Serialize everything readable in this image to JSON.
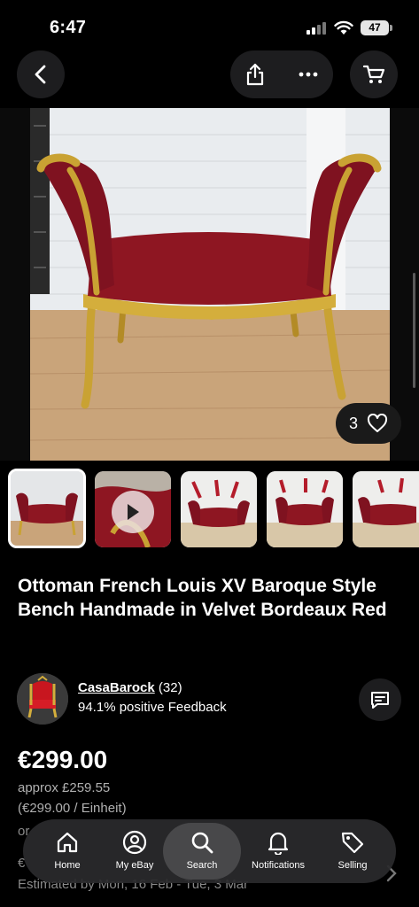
{
  "status_bar": {
    "time": "6:47",
    "battery": "47"
  },
  "nav": {
    "back_icon": "chevron-left-icon",
    "share_icon": "share-icon",
    "more_icon": "more-horizontal-icon",
    "cart_icon": "cart-icon"
  },
  "gallery": {
    "watch_count": "3",
    "watch_icon": "heart-icon"
  },
  "listing": {
    "title": "Ottoman French Louis XV Baroque Style Bench Handmade in Velvet Bordeaux Red",
    "price": "€299.00",
    "approx_price": "approx £259.55",
    "unit_price": "(€299.00 / Einheit)",
    "partial_line_1": "or",
    "partial_line_2": "€",
    "estimated_delivery": "Estimated by Mon, 16 Feb - Tue, 3 Mar"
  },
  "seller": {
    "name": "CasaBarock",
    "feedback_count": "(32)",
    "feedback": "94.1% positive Feedback"
  },
  "tabs": [
    {
      "label": "Home",
      "icon": "home-icon"
    },
    {
      "label": "My eBay",
      "icon": "user-icon"
    },
    {
      "label": "Search",
      "icon": "search-icon"
    },
    {
      "label": "Notifications",
      "icon": "bell-icon"
    },
    {
      "label": "Selling",
      "icon": "tag-icon"
    }
  ],
  "colors": {
    "background": "#000000",
    "surface": "#1d1d1f",
    "velvet": "#8e1622",
    "gold": "#c9a233"
  }
}
